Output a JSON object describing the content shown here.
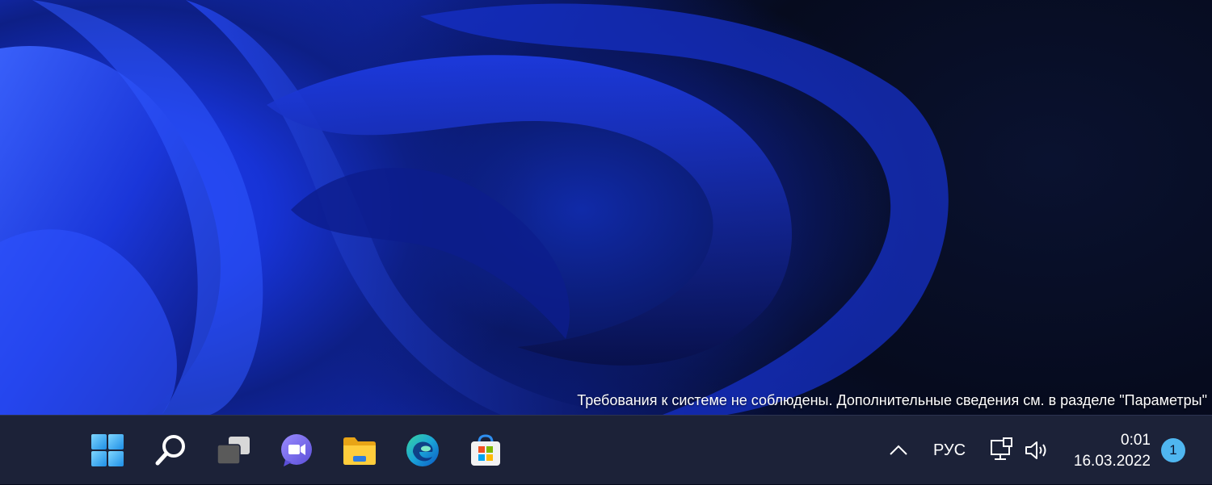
{
  "desktop": {
    "notice": "Требования к системе не соблюдены. Дополнительные сведения см. в разделе \"Параметры\""
  },
  "taskbar": {
    "pinned": [
      {
        "name": "start",
        "icon": "windows-logo-icon"
      },
      {
        "name": "search",
        "icon": "search-icon"
      },
      {
        "name": "task-view",
        "icon": "task-view-icon"
      },
      {
        "name": "chat",
        "icon": "chat-icon"
      },
      {
        "name": "file-explorer",
        "icon": "folder-icon"
      },
      {
        "name": "edge",
        "icon": "edge-icon"
      },
      {
        "name": "store",
        "icon": "store-icon"
      }
    ],
    "tray": {
      "overflow_icon": "chevron-up-icon",
      "language": "РУС",
      "network_icon": "network-icon",
      "volume_icon": "volume-icon"
    },
    "clock": {
      "time": "0:01",
      "date": "16.03.2022"
    },
    "notification_count": "1"
  },
  "colors": {
    "accent": "#4fb6f0",
    "taskbar_bg": "#1c2238",
    "wallpaper_blue": "#1f3ff5"
  }
}
